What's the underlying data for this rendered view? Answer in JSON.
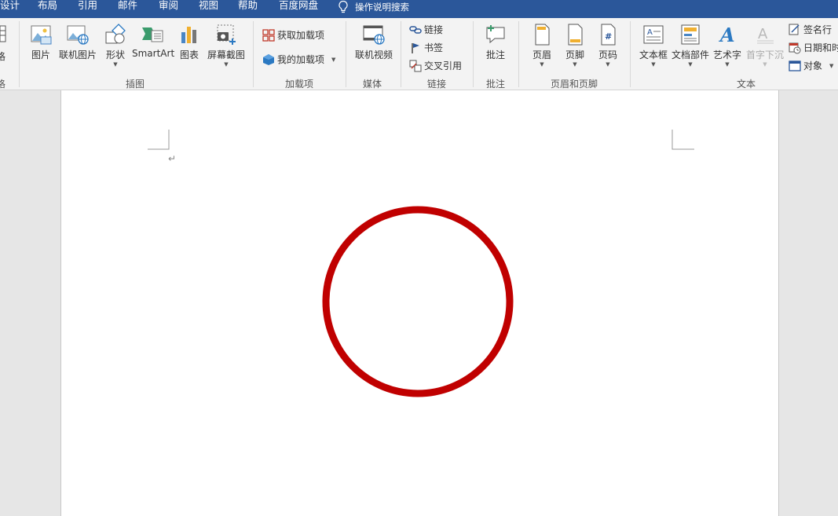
{
  "menu": {
    "tabs": [
      "设计",
      "布局",
      "引用",
      "邮件",
      "审阅",
      "视图",
      "帮助",
      "百度网盘"
    ],
    "search_label": "操作说明搜索"
  },
  "ribbon": {
    "partial_left_top": "格",
    "partial_left_group": "格",
    "illustrations": {
      "items": [
        "图片",
        "联机图片",
        "形状",
        "SmartArt",
        "图表",
        "屏幕截图"
      ],
      "group_label": "插图"
    },
    "addins": {
      "get_addins": "获取加载项",
      "my_addins": "我的加载项",
      "group_label": "加载项"
    },
    "media": {
      "online_video": "联机视频",
      "group_label": "媒体"
    },
    "links": {
      "link": "链接",
      "bookmark": "书签",
      "cross_ref": "交叉引用",
      "group_label": "链接"
    },
    "comments": {
      "comment": "批注",
      "group_label": "批注"
    },
    "header_footer": {
      "header": "页眉",
      "footer": "页脚",
      "page_number": "页码",
      "group_label": "页眉和页脚"
    },
    "text": {
      "textbox": "文本框",
      "quick_parts": "文档部件",
      "wordart": "艺术字",
      "dropcap": "首字下沉",
      "signature": "签名行",
      "datetime": "日期和时",
      "object": "对象",
      "group_label": "文本"
    }
  },
  "document": {
    "paragraph_mark": "↵",
    "shape": {
      "type": "circle",
      "stroke_color": "#c00000",
      "fill": "none"
    }
  },
  "colors": {
    "menubar": "#2b579a",
    "ribbon": "#f3f3f3",
    "accent_red": "#c00000"
  }
}
